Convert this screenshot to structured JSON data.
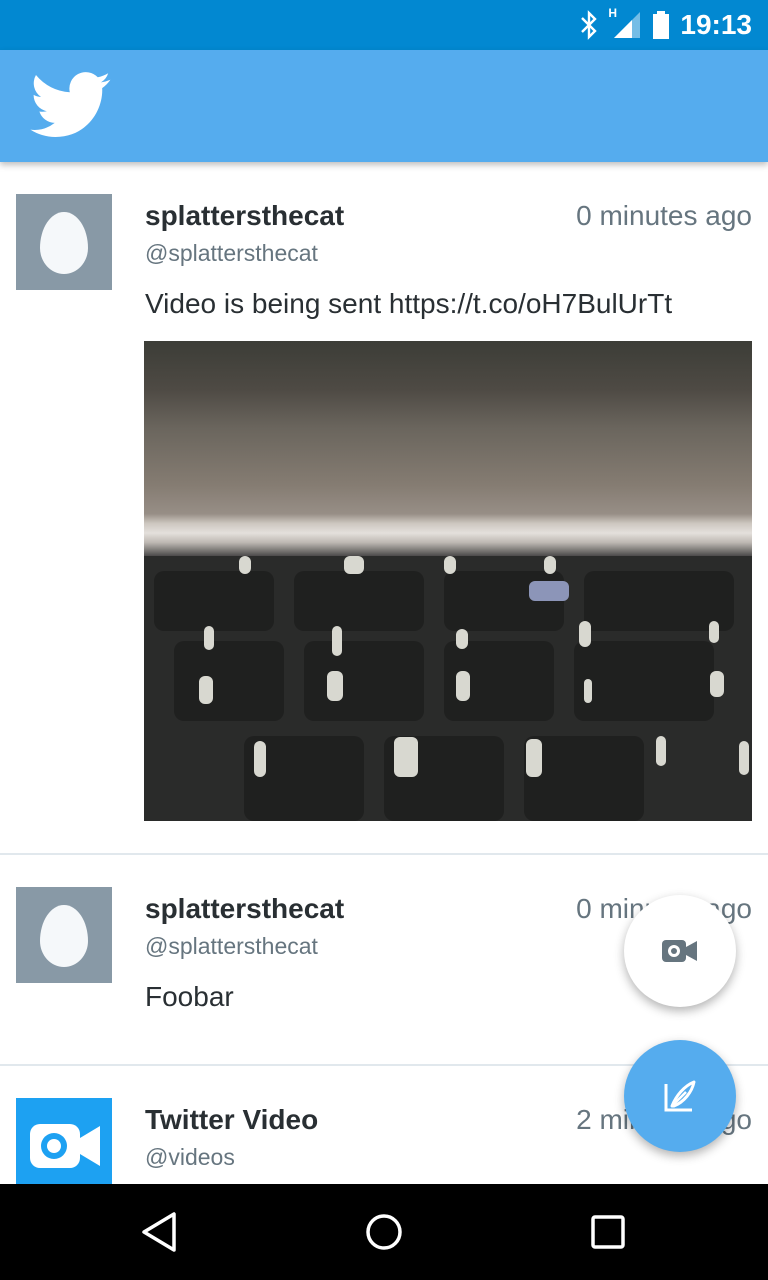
{
  "status_bar": {
    "time": "19:13",
    "network_label": "H",
    "icons": [
      "bluetooth-icon",
      "signal-icon",
      "battery-icon"
    ]
  },
  "app_bar": {
    "logo_icon": "twitter-bird-icon",
    "color": "#55acee"
  },
  "tweets": [
    {
      "display_name": "splattersthecat",
      "handle": "@splattersthecat",
      "timestamp": "0 minutes ago",
      "text": "Video is being sent https://t.co/oH7BulUrTt",
      "avatar": "egg-avatar",
      "has_media": true
    },
    {
      "display_name": "splattersthecat",
      "handle": "@splattersthecat",
      "timestamp": "0 minutes ago",
      "text": "Foobar",
      "avatar": "egg-avatar"
    },
    {
      "display_name": "Twitter Video",
      "handle": "@videos",
      "timestamp": "2 minutes ago",
      "avatar": "video-camera-avatar"
    }
  ],
  "fabs": {
    "camera_icon": "video-camera-icon",
    "compose_icon": "compose-feather-icon"
  },
  "nav_bar": {
    "buttons": [
      "back-icon",
      "home-icon",
      "recents-icon"
    ]
  },
  "colors": {
    "status_bar": "#0288d1",
    "accent": "#55acee",
    "text_primary": "#292f33",
    "text_secondary": "#66757f"
  }
}
